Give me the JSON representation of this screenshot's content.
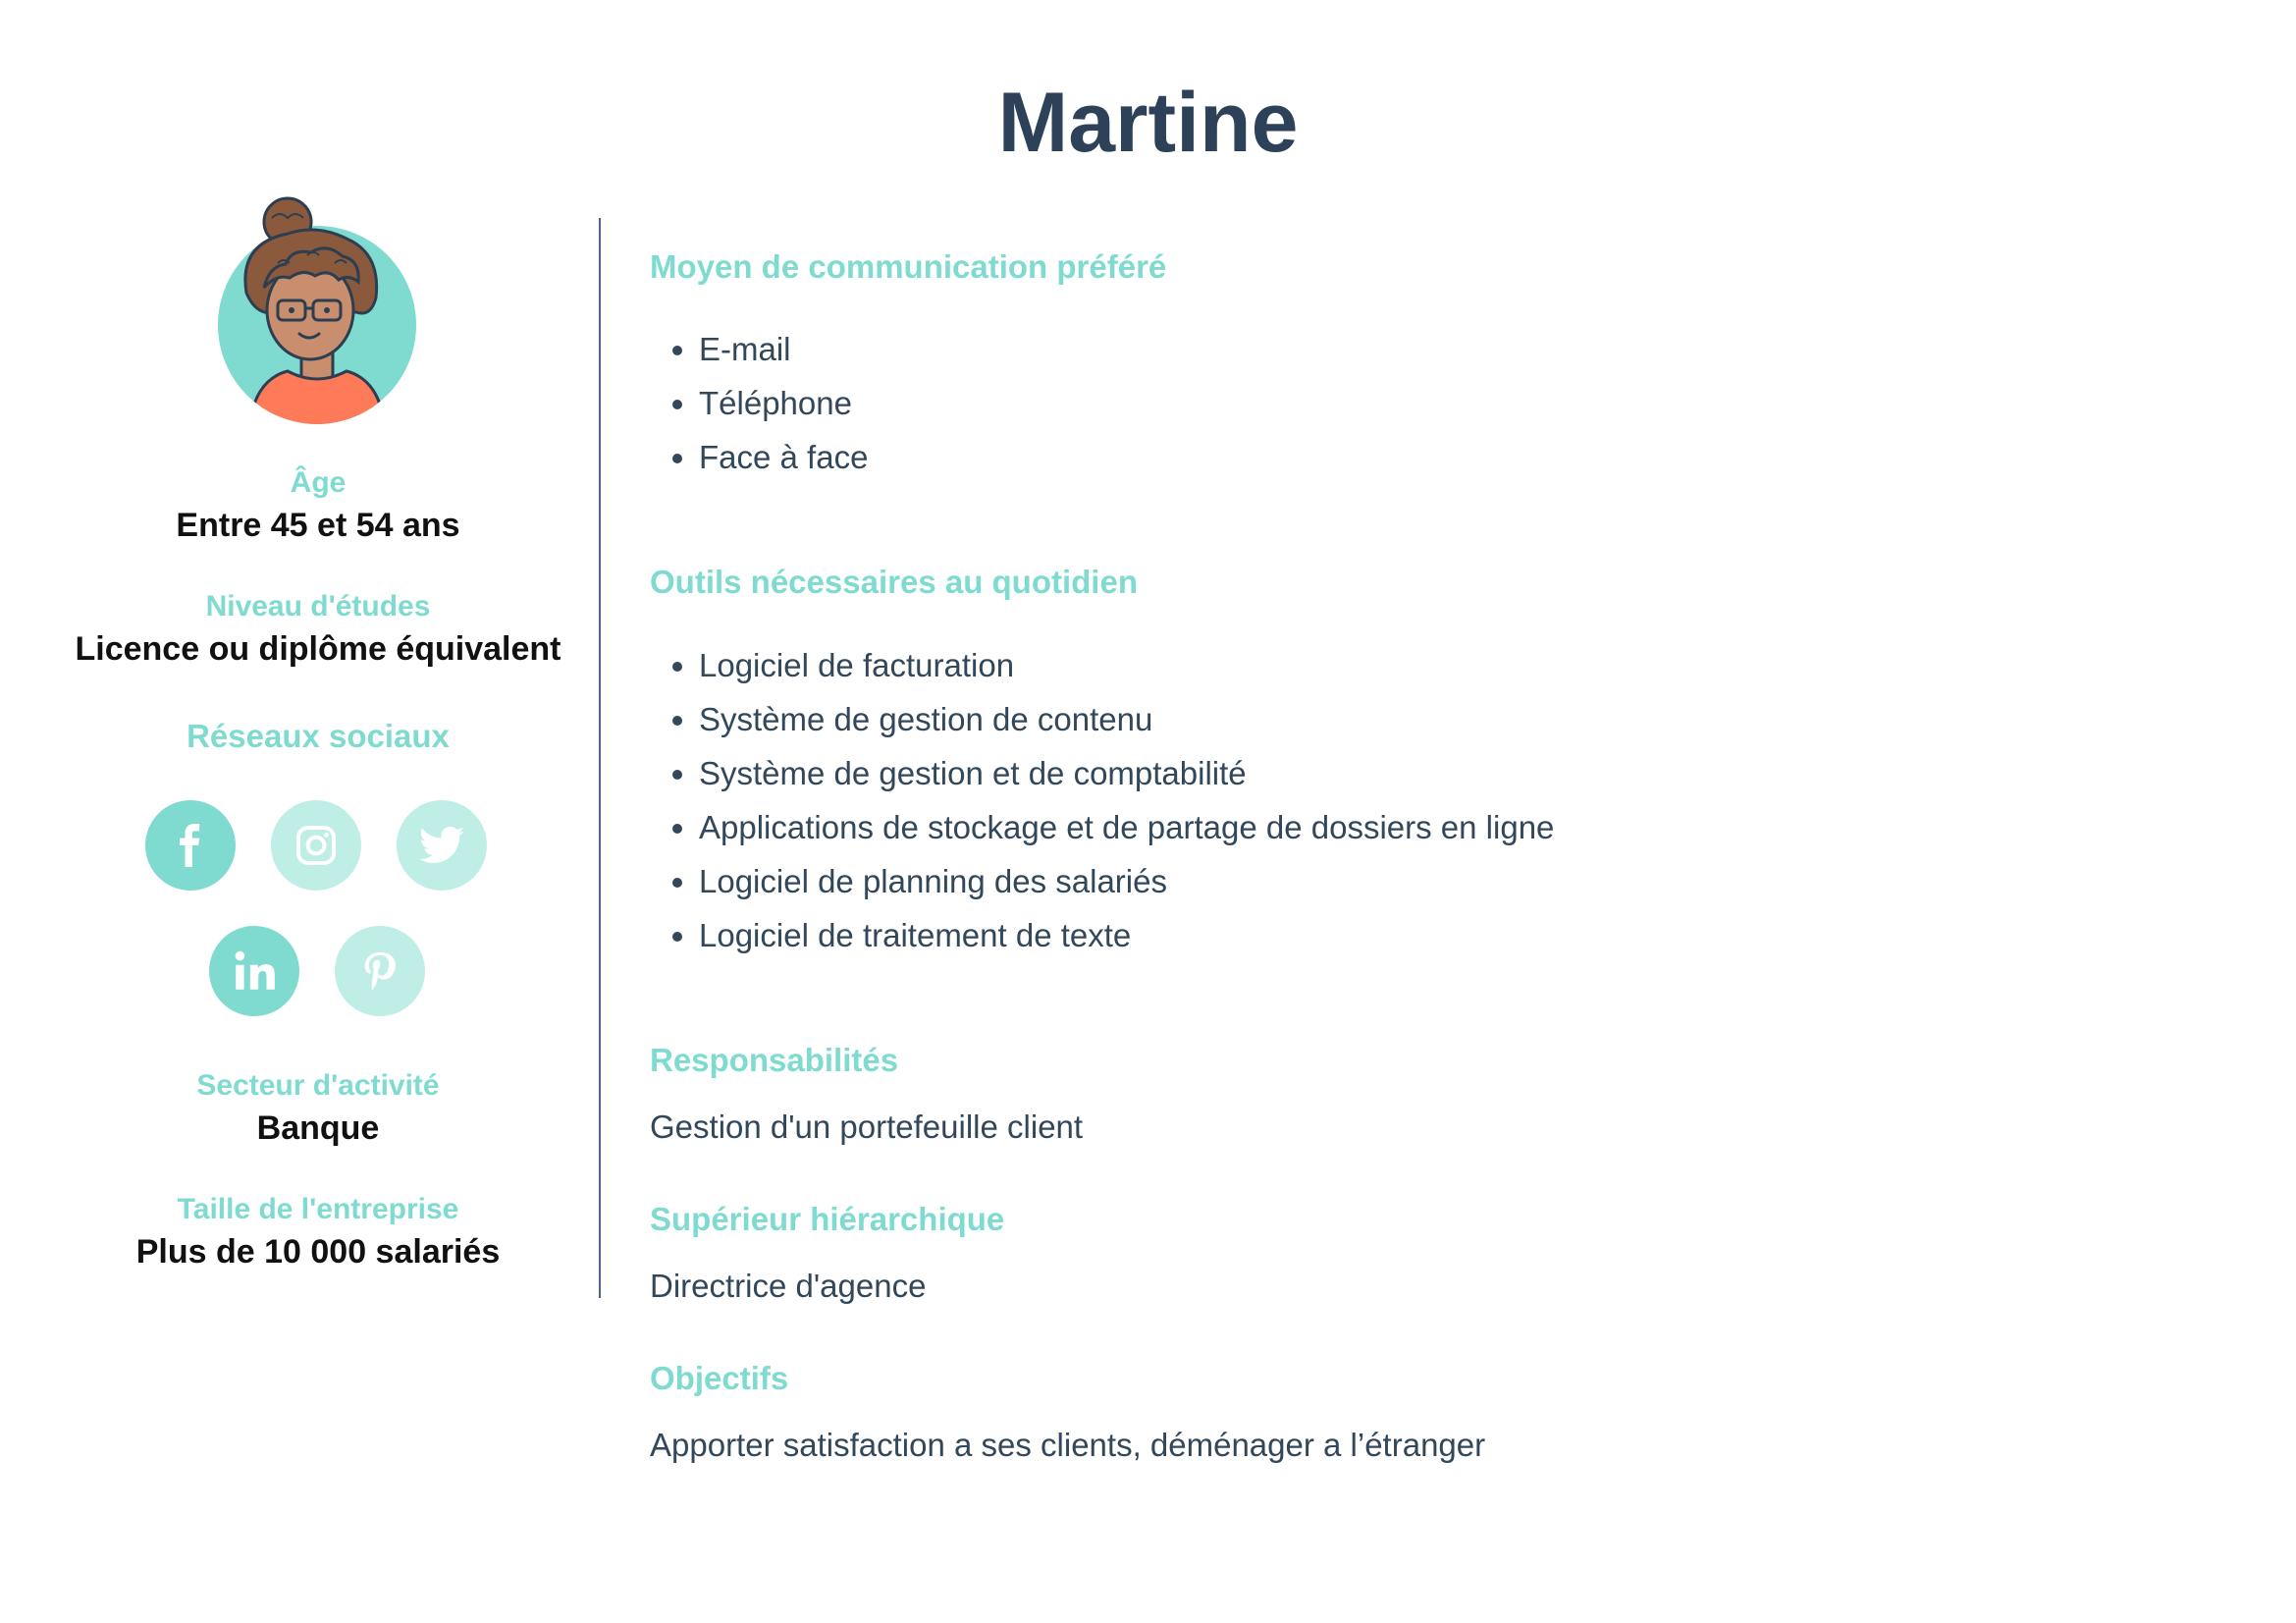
{
  "title": "Martine",
  "profile": {
    "age_label": "Âge",
    "age_value": "Entre 45 et 54 ans",
    "education_label": "Niveau d'études",
    "education_value": "Licence ou diplôme équivalent",
    "social_label": "Réseaux sociaux",
    "sector_label": "Secteur d'activité",
    "sector_value": "Banque",
    "company_size_label": "Taille de l'entreprise",
    "company_size_value": "Plus de 10 000 salariés"
  },
  "social_icons": [
    "facebook-icon",
    "instagram-icon",
    "twitter-icon",
    "linkedin-icon",
    "pinterest-icon"
  ],
  "colors": {
    "accent": "#7fdbd0",
    "accent_light": "#bfeee7",
    "heading": "#2d4259",
    "text": "#33475b",
    "divider": "#4a6686"
  },
  "sections": {
    "communication": {
      "heading": "Moyen de communication préféré",
      "items": [
        "E-mail",
        "Téléphone",
        "Face à face"
      ]
    },
    "tools": {
      "heading": "Outils nécessaires au quotidien",
      "items": [
        "Logiciel de facturation",
        "Système de gestion de contenu",
        "Système de gestion et de comptabilité",
        "Applications de stockage et de partage de dossiers en ligne",
        "Logiciel de planning des salariés",
        "Logiciel de traitement de texte"
      ]
    },
    "responsibilities": {
      "heading": "Responsabilités",
      "text": "Gestion d'un portefeuille client"
    },
    "manager": {
      "heading": "Supérieur hiérarchique",
      "text": "Directrice d'agence"
    },
    "goals": {
      "heading": "Objectifs",
      "text": "Apporter satisfaction a ses clients, déménager a l’étranger"
    }
  }
}
